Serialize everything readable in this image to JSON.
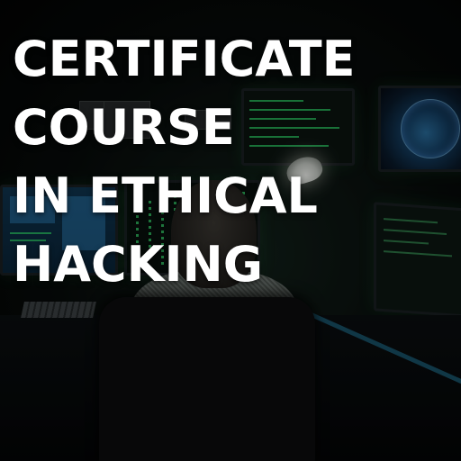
{
  "headline": {
    "lines": [
      "CERTIFICATE",
      "COURSE",
      "IN ETHICAL",
      "HACKING"
    ],
    "color": "#ffffff"
  },
  "background": {
    "description_colors": {
      "code": "#2fd86a",
      "screen_blue": "#2d7fb8",
      "globe": "#2a6e9e"
    }
  }
}
